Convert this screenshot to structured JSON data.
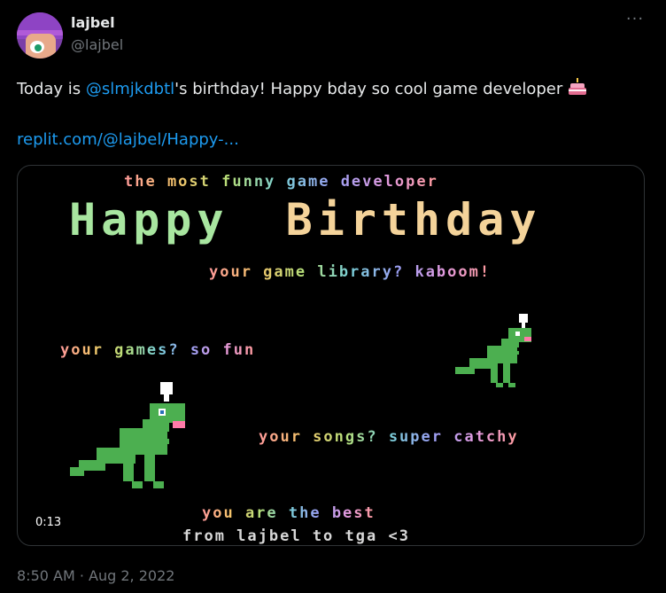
{
  "author": {
    "name": "lajbel",
    "handle": "@lajbel"
  },
  "more_icon": "more-dots-icon",
  "tweet": {
    "prefix": "Today is ",
    "mention": "@slmjkdbtl",
    "suffix": "'s birthday! Happy bday so cool game developer",
    "emoji": "birthday-cake-icon",
    "link": "replit.com/@lajbel/Happy-..."
  },
  "video": {
    "line1": "the most funny game developer",
    "headline_word1": "Happy",
    "headline_word2": "Birthday",
    "line2": "your game library? kaboom!",
    "line3": "your games? so fun",
    "line4": "your songs? super catchy",
    "line5": "you are the best",
    "line6": "from lajbel to tga <3",
    "time": "0:13"
  },
  "timestamp": "8:50 AM · Aug 2, 2022",
  "colors": {
    "link": "#1d9bf0",
    "dino": "#4caf50",
    "text_muted": "#71767b"
  }
}
